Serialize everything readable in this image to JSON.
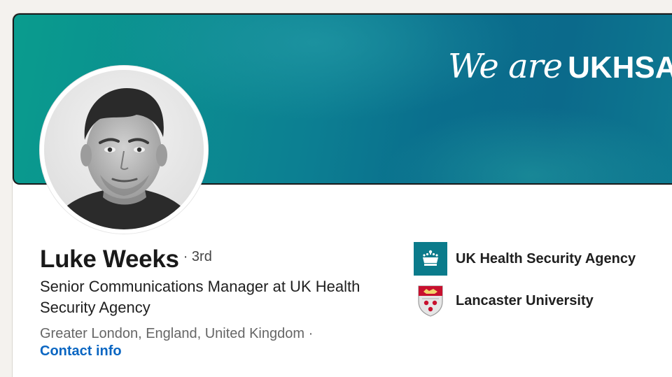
{
  "banner": {
    "script_text": "We are",
    "bold_text": "UKHSA"
  },
  "profile": {
    "name": "Luke Weeks",
    "degree": "· 3rd",
    "headline": "Senior Communications Manager at UK Health Security Agency",
    "location": "Greater London, England, United Kingdom ·",
    "contact_label": "Contact info"
  },
  "organizations": [
    {
      "name": "UK Health Security Agency",
      "logo": "ukhsa-crown-logo"
    },
    {
      "name": "Lancaster University",
      "logo": "lancaster-university-crest"
    }
  ],
  "colors": {
    "banner_teal": "#0a8f90",
    "link_blue": "#0a66c2",
    "ukhsa_logo_bg": "#0b7b8b",
    "lancaster_red": "#c8102e"
  }
}
